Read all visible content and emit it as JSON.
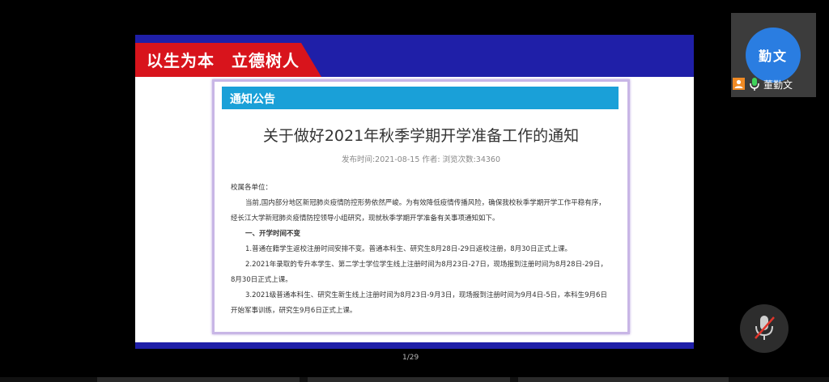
{
  "slide": {
    "slogan": "以生为本　立德树人",
    "notice_label": "通知公告",
    "title": "关于做好2021年秋季学期开学准备工作的通知",
    "meta": "发布时间:2021-08-15 作者:  浏览次数:34360",
    "paragraphs": {
      "p0": "校属各单位：",
      "p1": "当前,国内部分地区新冠肺炎疫情防控形势依然严峻。为有效降低疫情传播风险，确保我校秋季学期开学工作平稳有序，经长江大学新冠肺炎疫情防控领导小组研究，现就秋季学期开学准备有关事项通知如下。",
      "h1": "一、开学时间不变",
      "p2": "1.普通在籍学生返校注册时间安排不变。普通本科生、研究生8月28日-29日返校注册，8月30日正式上课。",
      "p3": "2.2021年录取的专升本学生、第二学士学位学生线上注册时间为8月23日-27日，现场报到注册时间为8月28日-29日，8月30日正式上课。",
      "p4": "3.2021级普通本科生、研究生新生线上注册时间为8月23日-9月3日，现场报到注册时间为9月4日-5日，本科生9月6日开始军事训练，研究生9月6日正式上课。"
    }
  },
  "pager": {
    "counter": "1/29"
  },
  "participant": {
    "avatar_text": "勤文",
    "name": "董勤文",
    "avatar_color": "#2a7de1"
  },
  "icons": {
    "host": "host-person-icon",
    "mic": "microphone-icon",
    "mute": "muted-microphone-icon"
  },
  "colors": {
    "band_blue": "#1f1fa8",
    "slogan_red": "#d8141c",
    "notice_blue": "#1aa0d8"
  }
}
